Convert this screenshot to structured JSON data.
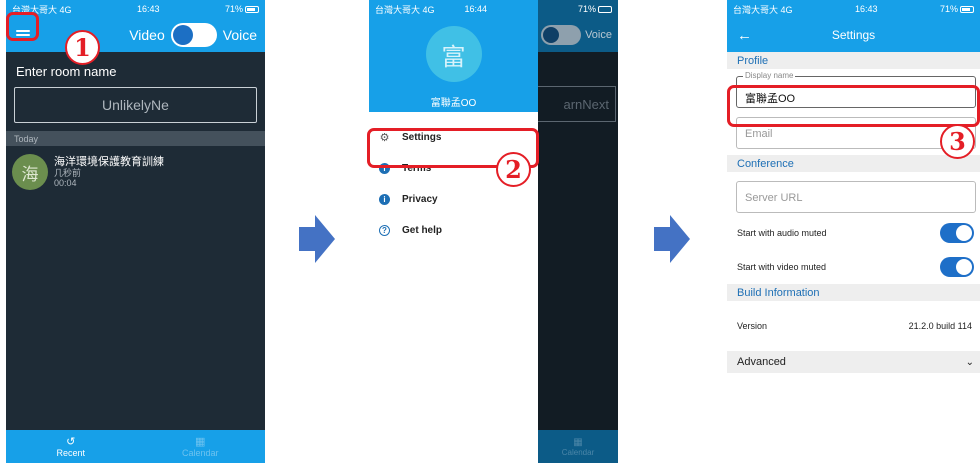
{
  "colors": {
    "accent": "#17a0e8",
    "highlight": "#e41e26",
    "arrow": "#4472c4"
  },
  "screen1": {
    "status": {
      "carrier": "台灣大哥大 4G",
      "time": "16:43",
      "battery": "71%"
    },
    "toolbar": {
      "menu_icon": "hamburger-menu-icon",
      "video_label": "Video",
      "voice_label": "Voice"
    },
    "room_label": "Enter room name",
    "room_input_value": "UnlikelyNe",
    "section_today": "Today",
    "recent": {
      "avatar_letter": "海",
      "title": "海洋環境保護教育訓練",
      "time_ago": "几秒前",
      "duration": "00:04"
    },
    "bottom_tabs": {
      "recent": "Recent",
      "calendar": "Calendar"
    }
  },
  "screen2": {
    "status": {
      "carrier": "台灣大哥大 4G",
      "time": "16:44",
      "battery": "71%"
    },
    "profile": {
      "avatar_letter": "富",
      "name": "富聯孟OO"
    },
    "menu": [
      {
        "label": "Settings",
        "icon": "gear-icon"
      },
      {
        "label": "Terms",
        "icon": "info-icon"
      },
      {
        "label": "Privacy",
        "icon": "info-icon"
      },
      {
        "label": "Get help",
        "icon": "help-icon"
      }
    ],
    "overlay": {
      "voice_label": "Voice",
      "room_input_value": "arnNext",
      "calendar_label": "Calendar"
    }
  },
  "screen3": {
    "status": {
      "carrier": "台灣大哥大 4G",
      "time": "16:43",
      "battery": "71%"
    },
    "title": "Settings",
    "profile_header": "Profile",
    "display_name_label": "Display name",
    "display_name_value": "富聯孟OO",
    "email_placeholder": "Email",
    "conference_header": "Conference",
    "server_url_placeholder": "Server URL",
    "audio_muted_label": "Start with audio muted",
    "video_muted_label": "Start with video muted",
    "build_header": "Build Information",
    "version_label": "Version",
    "version_value": "21.2.0 build 114",
    "advanced_label": "Advanced"
  },
  "steps": [
    "1",
    "2",
    "3"
  ]
}
